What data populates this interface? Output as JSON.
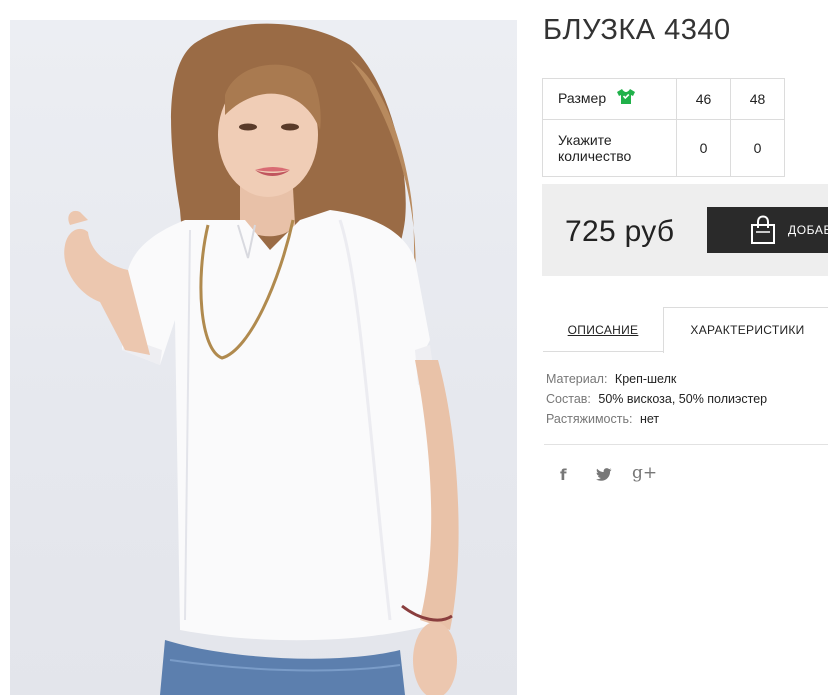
{
  "product": {
    "title": "БЛУЗКА 4340"
  },
  "sizes": {
    "size_label": "Размер",
    "size_icon": "shirt-icon",
    "values": [
      "46",
      "48"
    ],
    "quantity_label_line1": "Укажите",
    "quantity_label_line2": "количество",
    "quantities": [
      "0",
      "0"
    ]
  },
  "buy": {
    "price": "725 руб",
    "add_label": "ДОБАВ",
    "add_icon": "shopping-bag-icon"
  },
  "tabs": {
    "description": "ОПИСАНИЕ",
    "characteristics": "ХАРАКТЕРИСТИКИ"
  },
  "specs": [
    {
      "key": "Материал:",
      "value": "Креп-шелк"
    },
    {
      "key": "Состав:",
      "value": "50% вискоза, 50% полиэстер"
    },
    {
      "key": "Растяжимость:",
      "value": "нет"
    }
  ],
  "social": {
    "facebook": "f",
    "twitter_icon": "twitter-icon",
    "googleplus": "g+"
  },
  "colors": {
    "accent_green": "#20b14a",
    "button_dark": "#2a2a2a",
    "panel_gray": "#eeeeee"
  }
}
